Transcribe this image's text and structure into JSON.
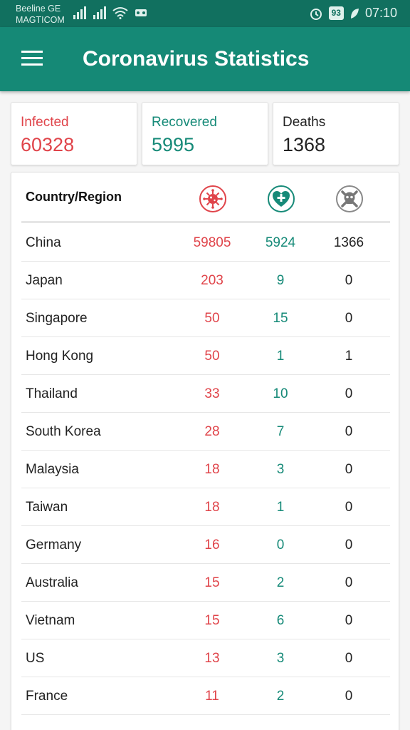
{
  "status_bar": {
    "carrier_line1": "Beeline GE",
    "carrier_line2": "MAGTICOM",
    "battery": "93",
    "time": "07:10",
    "icons": [
      "signal-icon",
      "signal-icon",
      "wifi-icon",
      "notification-icon",
      "alarm-icon",
      "battery-icon",
      "leaf-icon"
    ]
  },
  "app_bar": {
    "title": "Coronavirus Statistics",
    "menu_icon": "hamburger-menu-icon"
  },
  "summary": {
    "infected": {
      "label": "Infected",
      "value": "60328"
    },
    "recovered": {
      "label": "Recovered",
      "value": "5995"
    },
    "deaths": {
      "label": "Deaths",
      "value": "1368"
    }
  },
  "table": {
    "header_label": "Country/Region",
    "column_icons": [
      "virus-icon",
      "heart-plus-icon",
      "skull-icon"
    ],
    "rows": [
      {
        "country": "China",
        "infected": "59805",
        "recovered": "5924",
        "deaths": "1366"
      },
      {
        "country": "Japan",
        "infected": "203",
        "recovered": "9",
        "deaths": "0"
      },
      {
        "country": "Singapore",
        "infected": "50",
        "recovered": "15",
        "deaths": "0"
      },
      {
        "country": "Hong Kong",
        "infected": "50",
        "recovered": "1",
        "deaths": "1"
      },
      {
        "country": "Thailand",
        "infected": "33",
        "recovered": "10",
        "deaths": "0"
      },
      {
        "country": "South Korea",
        "infected": "28",
        "recovered": "7",
        "deaths": "0"
      },
      {
        "country": "Malaysia",
        "infected": "18",
        "recovered": "3",
        "deaths": "0"
      },
      {
        "country": "Taiwan",
        "infected": "18",
        "recovered": "1",
        "deaths": "0"
      },
      {
        "country": "Germany",
        "infected": "16",
        "recovered": "0",
        "deaths": "0"
      },
      {
        "country": "Australia",
        "infected": "15",
        "recovered": "2",
        "deaths": "0"
      },
      {
        "country": "Vietnam",
        "infected": "15",
        "recovered": "6",
        "deaths": "0"
      },
      {
        "country": "US",
        "infected": "13",
        "recovered": "3",
        "deaths": "0"
      },
      {
        "country": "France",
        "infected": "11",
        "recovered": "2",
        "deaths": "0"
      }
    ]
  },
  "colors": {
    "primary": "#158976",
    "status_bar": "#11705f",
    "infected": "#e0444a",
    "recovered": "#168a78",
    "deaths": "#222222"
  }
}
